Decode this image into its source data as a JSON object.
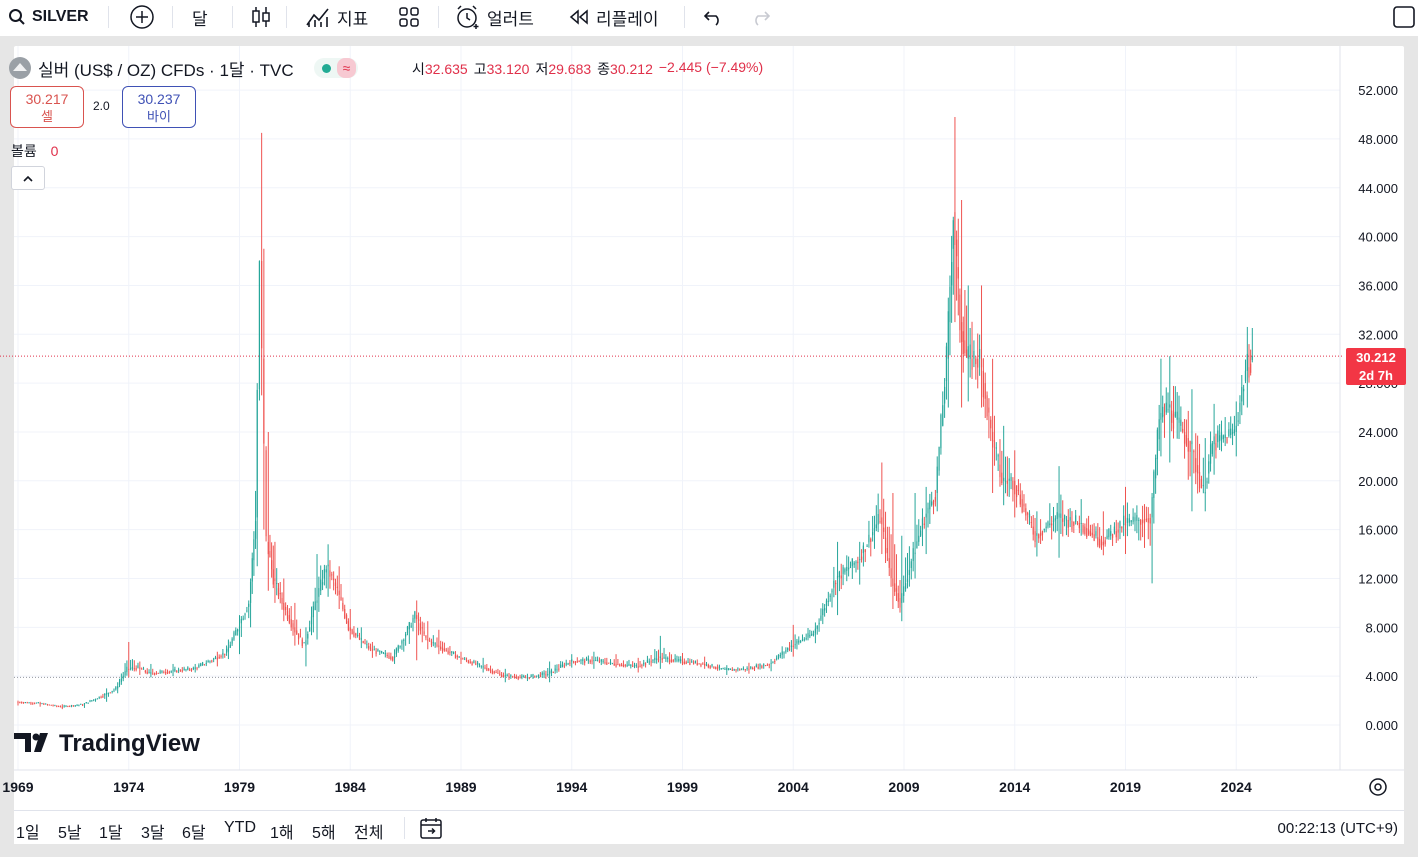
{
  "toolbar": {
    "symbol": "SILVER",
    "interval": "달",
    "indicators_label": "지표",
    "alert_label": "얼러트",
    "replay_label": "리플레이"
  },
  "legend": {
    "title": "실버 (US$ / OZ) CFDs · 1달 · TVC",
    "open_label": "시",
    "open": "32.635",
    "high_label": "고",
    "high": "33.120",
    "low_label": "저",
    "low": "29.683",
    "close_label": "종",
    "close": "30.212",
    "change": "−2.445 (−7.49%)",
    "change_color": "#e0304a"
  },
  "trade": {
    "sell_price": "30.217",
    "sell_label": "셀",
    "spread": "2.0",
    "buy_price": "30.237",
    "buy_label": "바이"
  },
  "volume": {
    "label": "볼륨",
    "value": "0"
  },
  "price_axis": {
    "ticks": [
      "52.000",
      "48.000",
      "44.000",
      "40.000",
      "36.000",
      "32.000",
      "28.000",
      "24.000",
      "20.000",
      "16.000",
      "12.000",
      "8.000",
      "4.000",
      "0.000"
    ],
    "last_price": "30.212",
    "countdown": "2d 7h"
  },
  "time_axis": {
    "ticks": [
      "1969",
      "1974",
      "1979",
      "1984",
      "1989",
      "1994",
      "1999",
      "2004",
      "2009",
      "2014",
      "2019",
      "2024"
    ]
  },
  "watermark": "TradingView",
  "periods": [
    "1일",
    "5날",
    "1달",
    "3달",
    "6달",
    "YTD",
    "1해",
    "5해",
    "전체"
  ],
  "clock": "00:22:13 (UTC+9)",
  "colors": {
    "up": "#26a69a",
    "down": "#ef5350",
    "accent": "#2962ff",
    "price_label_bg": "#f23645"
  },
  "chart_data": {
    "type": "candlestick",
    "title": "실버 (US$ / OZ) CFDs · 1달 · TVC",
    "xlabel": "",
    "ylabel": "",
    "ylim": [
      0,
      52
    ],
    "xlim": [
      1969,
      2025
    ],
    "grid": true,
    "series": [
      {
        "name": "",
        "x": [
          1969.0,
          1970.0,
          1971.0,
          1972.0,
          1973.0,
          1973.5,
          1974.0,
          1974.5,
          1975.0,
          1976.0,
          1977.0,
          1978.0,
          1978.5,
          1979.0,
          1979.5,
          1979.8,
          1980.0,
          1980.1,
          1980.3,
          1980.6,
          1981.0,
          1981.5,
          1982.0,
          1982.5,
          1983.0,
          1983.5,
          1984.0,
          1984.5,
          1985.0,
          1986.0,
          1987.0,
          1987.5,
          1988.0,
          1989.0,
          1990.0,
          1991.0,
          1992.0,
          1993.0,
          1994.0,
          1995.0,
          1996.0,
          1997.0,
          1998.0,
          1999.0,
          2000.0,
          2001.0,
          2002.0,
          2003.0,
          2004.0,
          2005.0,
          2006.0,
          2007.0,
          2008.0,
          2008.5,
          2008.9,
          2009.5,
          2010.0,
          2010.5,
          2011.0,
          2011.3,
          2011.6,
          2011.9,
          2012.5,
          2013.0,
          2013.5,
          2014.0,
          2015.0,
          2016.0,
          2017.0,
          2018.0,
          2019.0,
          2020.2,
          2020.6,
          2021.0,
          2022.0,
          2022.6,
          2023.0,
          2024.0,
          2024.5,
          2024.8
        ],
        "values": [
          1.9,
          1.8,
          1.5,
          1.7,
          2.5,
          3.0,
          4.6,
          4.7,
          4.2,
          4.4,
          4.6,
          5.5,
          6.0,
          8.0,
          10.0,
          17.0,
          38.0,
          30.0,
          15.0,
          12.0,
          10.0,
          8.0,
          6.5,
          10.0,
          13.0,
          11.0,
          8.0,
          7.0,
          6.2,
          5.5,
          9.0,
          7.0,
          6.5,
          5.5,
          4.8,
          4.0,
          3.9,
          4.2,
          5.2,
          5.3,
          5.0,
          4.8,
          5.5,
          5.2,
          5.0,
          4.5,
          4.6,
          5.0,
          6.5,
          7.5,
          12.0,
          13.5,
          17.0,
          12.0,
          10.0,
          14.0,
          17.0,
          19.0,
          30.0,
          42.0,
          33.0,
          30.0,
          30.0,
          24.0,
          20.0,
          20.0,
          15.5,
          17.0,
          16.5,
          15.0,
          16.5,
          17.0,
          25.0,
          26.0,
          23.0,
          19.0,
          23.0,
          24.0,
          29.0,
          30.2
        ],
        "highs": [
          2.0,
          1.9,
          1.7,
          1.8,
          3.0,
          3.5,
          6.8,
          5.2,
          5.0,
          5.0,
          5.0,
          6.0,
          7.0,
          9.0,
          12.0,
          28.0,
          48.5,
          39.0,
          24.0,
          15.0,
          12.0,
          10.0,
          8.0,
          14.0,
          14.8,
          13.0,
          9.5,
          8.0,
          6.8,
          6.2,
          10.2,
          8.5,
          7.8,
          6.0,
          5.5,
          4.6,
          4.2,
          5.2,
          5.8,
          6.0,
          5.8,
          5.5,
          7.3,
          5.9,
          5.6,
          4.9,
          5.1,
          5.4,
          8.2,
          8.4,
          15.0,
          15.0,
          21.5,
          19.0,
          15.5,
          19.0,
          19.5,
          22.0,
          35.0,
          49.8,
          43.0,
          36.0,
          36.0,
          30.0,
          24.5,
          22.5,
          17.5,
          21.2,
          18.5,
          17.5,
          19.5,
          19.0,
          30.0,
          30.2,
          27.5,
          23.5,
          26.3,
          26.5,
          32.6,
          35.0
        ],
        "lows": [
          1.6,
          1.5,
          1.3,
          1.4,
          1.9,
          2.6,
          3.9,
          4.1,
          3.9,
          4.0,
          4.3,
          4.8,
          5.4,
          5.8,
          8.0,
          13.0,
          27.0,
          16.0,
          11.0,
          10.0,
          8.5,
          6.5,
          4.8,
          7.0,
          10.5,
          9.5,
          7.0,
          6.3,
          5.5,
          5.0,
          5.3,
          6.2,
          5.8,
          5.0,
          4.3,
          3.5,
          3.6,
          3.5,
          4.7,
          4.6,
          4.7,
          4.3,
          4.6,
          4.9,
          4.6,
          4.1,
          4.2,
          4.4,
          5.6,
          6.7,
          9.0,
          11.5,
          14.0,
          9.5,
          8.5,
          12.0,
          14.0,
          17.5,
          26.0,
          33.0,
          26.0,
          26.5,
          26.0,
          19.0,
          18.0,
          17.0,
          13.8,
          13.7,
          15.5,
          13.9,
          14.0,
          11.6,
          22.0,
          21.5,
          17.5,
          17.5,
          20.5,
          22.0,
          26.0,
          29.7
        ]
      }
    ],
    "price_line": 30.212,
    "reference_line": 3.9
  }
}
